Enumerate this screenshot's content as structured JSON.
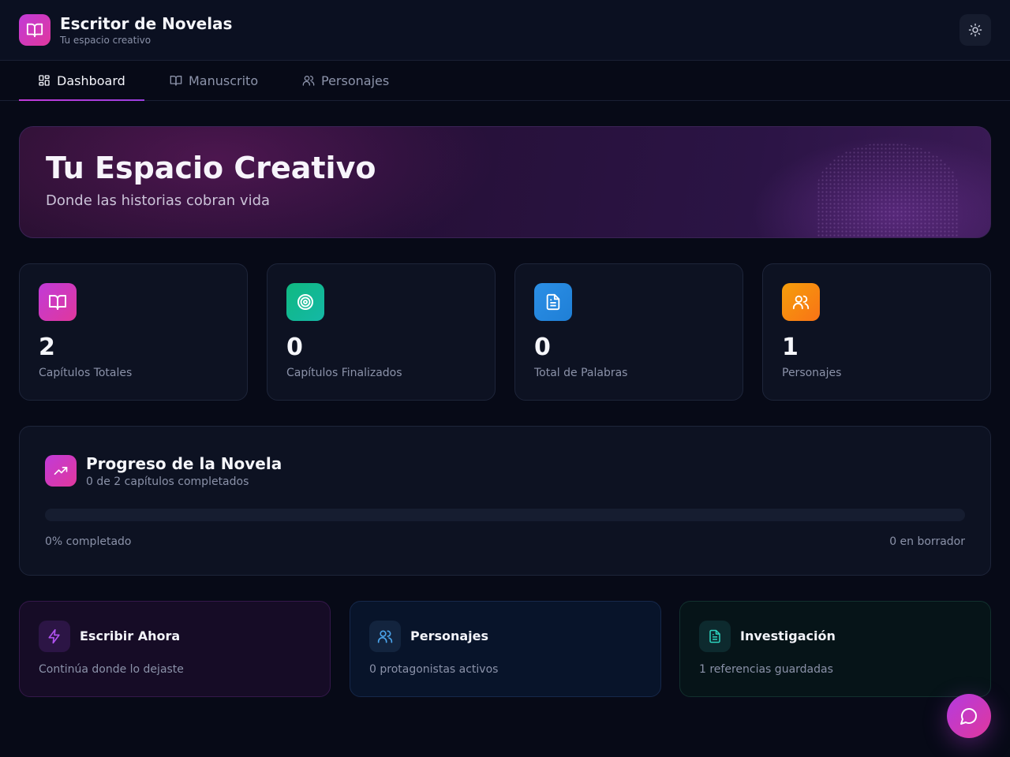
{
  "header": {
    "title": "Escritor de Novelas",
    "subtitle": "Tu espacio creativo",
    "logo_icon": "book-open-icon",
    "theme_icon": "sun-icon"
  },
  "tabs": [
    {
      "label": "Dashboard",
      "icon": "dashboard-icon",
      "active": true
    },
    {
      "label": "Manuscrito",
      "icon": "book-open-icon",
      "active": false
    },
    {
      "label": "Personajes",
      "icon": "users-icon",
      "active": false
    }
  ],
  "hero": {
    "title": "Tu Espacio Creativo",
    "subtitle": "Donde las historias cobran vida"
  },
  "stats": [
    {
      "value": "2",
      "label": "Capítulos Totales",
      "icon": "book-open-icon",
      "color": "#c13ad8"
    },
    {
      "value": "0",
      "label": "Capítulos Finalizados",
      "icon": "target-icon",
      "color": "#14b8a6"
    },
    {
      "value": "0",
      "label": "Total de Palabras",
      "icon": "file-text-icon",
      "color": "#2b8fe6"
    },
    {
      "value": "1",
      "label": "Personajes",
      "icon": "users-icon",
      "color": "#f97316"
    }
  ],
  "progress": {
    "title": "Progreso de la Novela",
    "subtitle": "0 de 2 capítulos completados",
    "percent": 0,
    "left_label": "0% completado",
    "right_label": "0 en borrador",
    "icon": "trending-up-icon"
  },
  "quick_actions": [
    {
      "title": "Escribir Ahora",
      "desc": "Continúa donde lo dejaste",
      "icon": "lightning-icon",
      "color": "#a855f7"
    },
    {
      "title": "Personajes",
      "desc": "0 protagonistas activos",
      "icon": "users-icon",
      "color": "#4aa3ea"
    },
    {
      "title": "Investigación",
      "desc": "1 referencias guardadas",
      "icon": "file-text-icon",
      "color": "#2dd4bf"
    }
  ],
  "chat_icon": "chat-bubble-icon"
}
